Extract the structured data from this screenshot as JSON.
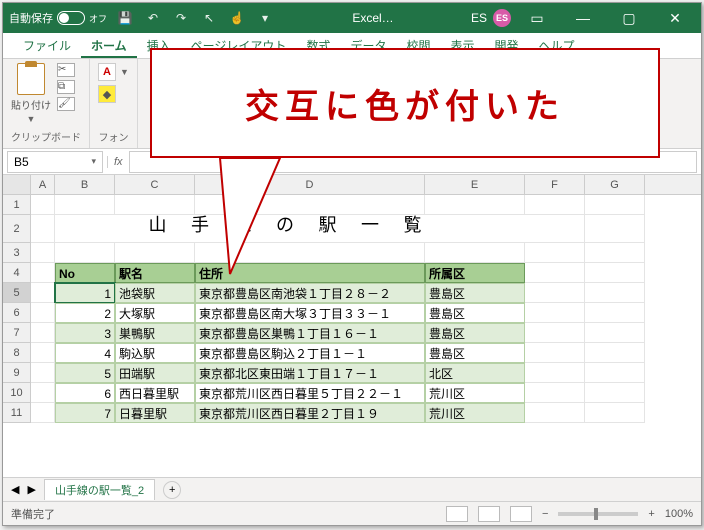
{
  "titlebar": {
    "autosave_label": "自動保存",
    "autosave_state": "オフ",
    "app_name": "Excel…",
    "user_initials": "ES",
    "user_badge": "ES"
  },
  "tabs": {
    "file": "ファイル",
    "home": "ホーム",
    "insert": "挿入",
    "pagelayout": "ページレイアウト",
    "formulas": "数式",
    "data": "データ",
    "review": "校閲",
    "view": "表示",
    "dev": "開発",
    "help": "ヘルプ"
  },
  "ribbon": {
    "paste": "貼り付け",
    "clipboard": "クリップボード",
    "font": "フォン"
  },
  "callout": "交互に色が付いた",
  "name_box": "B5",
  "sheet": {
    "title": "山 手 線 の 駅 一 覧",
    "headers": {
      "no": "No",
      "name": "駅名",
      "addr": "住所",
      "ward": "所属区"
    },
    "rows": [
      {
        "no": "1",
        "name": "池袋駅",
        "addr": "東京都豊島区南池袋１丁目２８－２",
        "ward": "豊島区"
      },
      {
        "no": "2",
        "name": "大塚駅",
        "addr": "東京都豊島区南大塚３丁目３３－１",
        "ward": "豊島区"
      },
      {
        "no": "3",
        "name": "巣鴨駅",
        "addr": "東京都豊島区巣鴨１丁目１６－１",
        "ward": "豊島区"
      },
      {
        "no": "4",
        "name": "駒込駅",
        "addr": "東京都豊島区駒込２丁目１－１",
        "ward": "豊島区"
      },
      {
        "no": "5",
        "name": "田端駅",
        "addr": "東京都北区東田端１丁目１７－１",
        "ward": "北区"
      },
      {
        "no": "6",
        "name": "西日暮里駅",
        "addr": "東京都荒川区西日暮里５丁目２２－１",
        "ward": "荒川区"
      },
      {
        "no": "7",
        "name": "日暮里駅",
        "addr": "東京都荒川区西日暮里２丁目１９",
        "ward": "荒川区"
      }
    ]
  },
  "sheet_tab": "山手線の駅一覧_2",
  "status": {
    "ready": "準備完了",
    "zoom": "100%"
  }
}
